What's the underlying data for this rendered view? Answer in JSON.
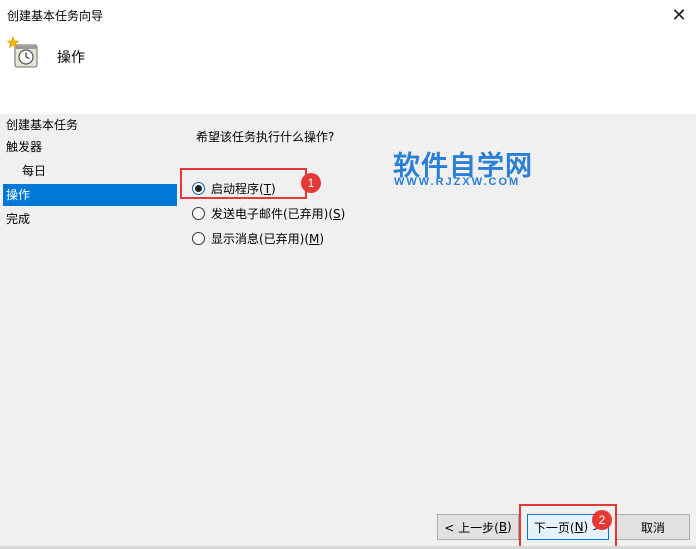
{
  "window": {
    "title": "创建基本任务向导",
    "close_glyph": "✕"
  },
  "header": {
    "title": "操作",
    "icon": "task-scheduler-clock-icon"
  },
  "nav": {
    "items": [
      {
        "label": "创建基本任务",
        "active": false,
        "sub": false
      },
      {
        "label": "触发器",
        "active": false,
        "sub": false
      },
      {
        "label": "每日",
        "active": false,
        "sub": true
      },
      {
        "label": "操作",
        "active": true,
        "sub": false
      },
      {
        "label": "完成",
        "active": false,
        "sub": false
      }
    ]
  },
  "main": {
    "question": "希望该任务执行什么操作?",
    "options": [
      {
        "label_main": "启动程序(",
        "accel": "T",
        "label_end": ")",
        "checked": true
      },
      {
        "label_main": "发送电子邮件(已弃用)(",
        "accel": "S",
        "label_end": ")",
        "checked": false
      },
      {
        "label_main": "显示消息(已弃用)(",
        "accel": "M",
        "label_end": ")",
        "checked": false
      }
    ]
  },
  "annotations": {
    "badge1": "1",
    "badge2": "2",
    "color": "#e53935"
  },
  "watermark": {
    "cn": "软件自学网",
    "en": "WWW.RJZXW.COM",
    "color": "#2a7fd6"
  },
  "buttons": {
    "back_main": "< 上一步(",
    "back_accel": "B",
    "back_end": ")",
    "next_main": "下一页(",
    "next_accel": "N",
    "next_end": ") >",
    "cancel": "取消"
  },
  "colors": {
    "accent": "#0078d7",
    "panel_bg": "#f0f0f0"
  }
}
